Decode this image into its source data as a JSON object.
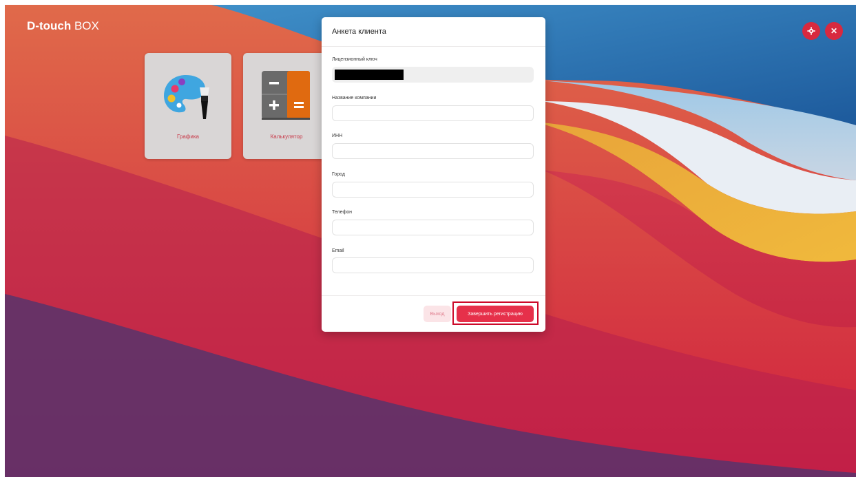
{
  "app": {
    "brand_bold": "D-touch",
    "brand_light": "BOX"
  },
  "header_buttons": [
    {
      "icon": "gear-icon",
      "glyph": "✿"
    },
    {
      "icon": "close-icon",
      "glyph": "✕"
    }
  ],
  "tiles": [
    {
      "label": "Графика",
      "icon": "palette-icon"
    },
    {
      "label": "Калькулятор",
      "icon": "calculator-icon"
    }
  ],
  "modal": {
    "title": "Анкета клиента",
    "fields": [
      {
        "label": "Лицензионный ключ",
        "value": "",
        "redacted": true
      },
      {
        "label": "Название компании",
        "value": ""
      },
      {
        "label": "ИНН",
        "value": ""
      },
      {
        "label": "Город",
        "value": ""
      },
      {
        "label": "Телефон",
        "value": ""
      },
      {
        "label": "Email",
        "value": ""
      }
    ],
    "exit_label": "Выход",
    "finish_label": "Завершить регистрацию"
  },
  "colors": {
    "accent": "#e6304a",
    "highlight_outline": "#cc0a2a"
  }
}
